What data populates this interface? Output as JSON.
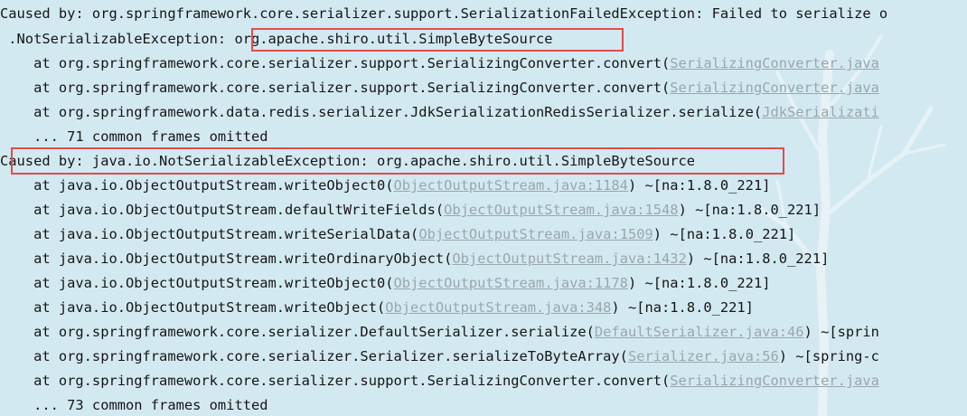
{
  "log": {
    "line1": "Caused by: org.springframework.core.serializer.support.SerializationFailedException: Failed to serialize o",
    "line2_prefix": " .NotSerializableException",
    "line2_highlight": ": org.apache.shiro.util.SimpleByteSource",
    "line3_text": "    at org.springframework.core.serializer.support.SerializingConverter.convert(",
    "line3_link": "SerializingConverter.java",
    "line4_text": "    at org.springframework.core.serializer.support.SerializingConverter.convert(",
    "line4_link": "SerializingConverter.java",
    "line5_text": "    at org.springframework.data.redis.serializer.JdkSerializationRedisSerializer.serialize(",
    "line5_link": "JdkSerializati",
    "line6": "    ... 71 common frames omitted",
    "line7": "Caused by: java.io.NotSerializableException: org.apache.shiro.util.SimpleByteSource",
    "line8_text": "    at java.io.ObjectOutputStream.writeObject0(",
    "line8_link": "ObjectOutputStream.java:1184",
    "line8_tail": ") ~[na:1.8.0_221]",
    "line9_text": "    at java.io.ObjectOutputStream.defaultWriteFields(",
    "line9_link": "ObjectOutputStream.java:1548",
    "line9_tail": ") ~[na:1.8.0_221]",
    "line10_text": "    at java.io.ObjectOutputStream.writeSerialData(",
    "line10_link": "ObjectOutputStream.java:1509",
    "line10_tail": ") ~[na:1.8.0_221]",
    "line11_text": "    at java.io.ObjectOutputStream.writeOrdinaryObject(",
    "line11_link": "ObjectOutputStream.java:1432",
    "line11_tail": ") ~[na:1.8.0_221]",
    "line12_text": "    at java.io.ObjectOutputStream.writeObject0(",
    "line12_link": "ObjectOutputStream.java:1178",
    "line12_tail": ") ~[na:1.8.0_221]",
    "line13_text": "    at java.io.ObjectOutputStream.writeObject(",
    "line13_link": "ObjectOutputStream.java:348",
    "line13_tail": ") ~[na:1.8.0_221]",
    "line14_text": "    at org.springframework.core.serializer.DefaultSerializer.serialize(",
    "line14_link": "DefaultSerializer.java:46",
    "line14_tail": ") ~[sprin",
    "line15_text": "    at org.springframework.core.serializer.Serializer.serializeToByteArray(",
    "line15_link": "Serializer.java:56",
    "line15_tail": ") ~[spring-c",
    "line16_text": "    at org.springframework.core.serializer.support.SerializingConverter.convert(",
    "line16_link": "SerializingConverter.java",
    "line17": "    ... 73 common frames omitted"
  },
  "colors": {
    "background": "#d3e9f2",
    "text": "#151515",
    "link": "#9aa6ad",
    "highlight_box": "#e24b4b"
  }
}
